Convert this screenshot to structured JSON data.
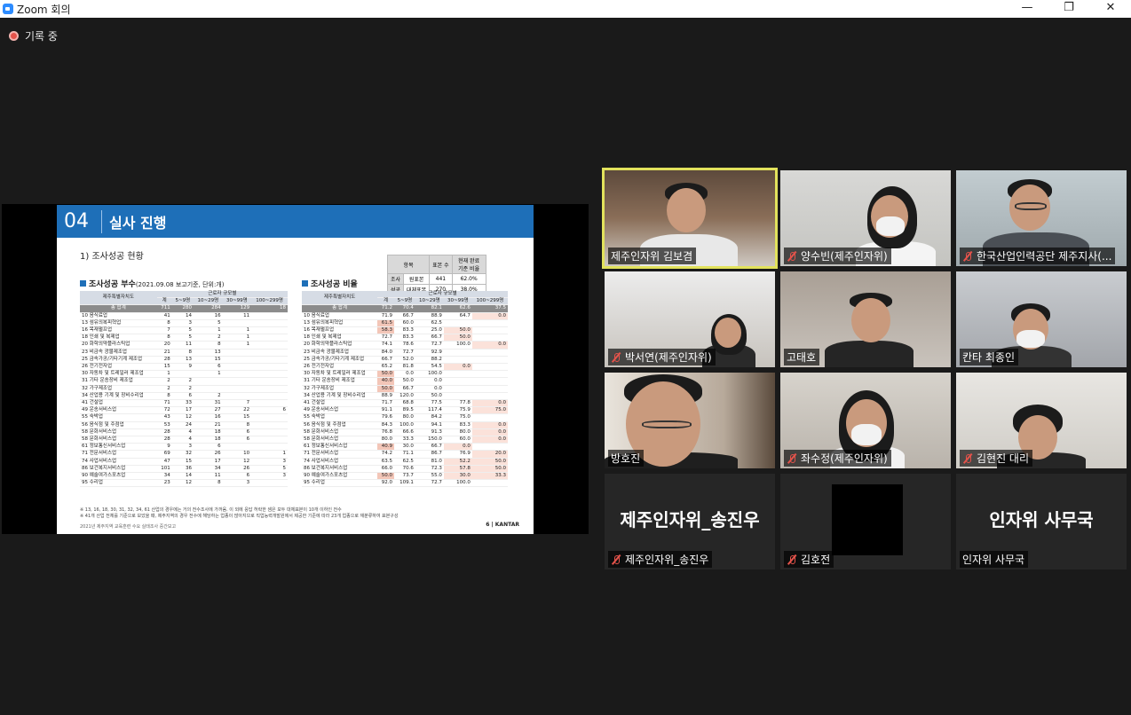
{
  "window": {
    "title": "Zoom 회의",
    "controls": {
      "minimize": "—",
      "restore": "❐",
      "close": "✕"
    }
  },
  "recording": {
    "label": "기록 중"
  },
  "slide": {
    "section_number": "04",
    "section_title": "실사 진행",
    "subtitle": "1) 조사성공 현황",
    "summary_table": {
      "headers": [
        "항목",
        "표본 수",
        "현재 완료 기준 비율"
      ],
      "rows": [
        [
          "조사",
          "원표본",
          "441",
          "62.0%"
        ],
        [
          "성공",
          "대체표본",
          "270",
          "38.0%"
        ]
      ]
    },
    "left_title": "조사성공 부수",
    "left_note": "(2021.09.08 보고기준, 단위:개)",
    "right_title": "조사성공 비율",
    "group_header": "근로자 규모별",
    "col_header": "제주특별자치도",
    "columns": [
      "계",
      "5~9명",
      "10~29명",
      "30~99명",
      "100~299명"
    ],
    "total_label": "총 합계",
    "left_total": [
      "711",
      "280",
      "284",
      "129",
      "18"
    ],
    "right_total": [
      "71.2",
      "70.4",
      "82.1",
      "62.6",
      "37.5"
    ],
    "rows": [
      {
        "label": "10 음식료업",
        "l": [
          "41",
          "14",
          "16",
          "11",
          ""
        ],
        "r": [
          "71.9",
          "66.7",
          "88.9",
          "64.7",
          "0.0"
        ]
      },
      {
        "label": "13 섬유의복피혁업",
        "l": [
          "8",
          "3",
          "5",
          "",
          ""
        ],
        "r": [
          "61.5",
          "60.0",
          "62.5",
          "",
          ""
        ]
      },
      {
        "label": "16 목재펄프업",
        "l": [
          "7",
          "5",
          "1",
          "1",
          ""
        ],
        "r": [
          "58.3",
          "83.3",
          "25.0",
          "50.0",
          ""
        ]
      },
      {
        "label": "18 인쇄 및 복제업",
        "l": [
          "8",
          "5",
          "2",
          "1",
          ""
        ],
        "r": [
          "72.7",
          "83.3",
          "66.7",
          "50.0",
          ""
        ]
      },
      {
        "label": "20 화학의약플라스틱업",
        "l": [
          "20",
          "11",
          "8",
          "1",
          ""
        ],
        "r": [
          "74.1",
          "78.6",
          "72.7",
          "100.0",
          "0.0"
        ]
      },
      {
        "label": "23 비금속 광물제조업",
        "l": [
          "21",
          "8",
          "13",
          "",
          ""
        ],
        "r": [
          "84.0",
          "72.7",
          "92.9",
          "",
          ""
        ]
      },
      {
        "label": "25 금속가공/기타기계 제조업",
        "l": [
          "28",
          "13",
          "15",
          "",
          ""
        ],
        "r": [
          "66.7",
          "52.0",
          "88.2",
          "",
          ""
        ]
      },
      {
        "label": "26 전기전자업",
        "l": [
          "15",
          "9",
          "6",
          "",
          ""
        ],
        "r": [
          "65.2",
          "81.8",
          "54.5",
          "0.0",
          ""
        ]
      },
      {
        "label": "30 자동차 및 트레일러 제조업",
        "l": [
          "1",
          "",
          "1",
          "",
          ""
        ],
        "r": [
          "50.0",
          "0.0",
          "100.0",
          "",
          ""
        ]
      },
      {
        "label": "31 기타 운송장비 제조업",
        "l": [
          "2",
          "2",
          "",
          "",
          ""
        ],
        "r": [
          "40.0",
          "50.0",
          "0.0",
          "",
          ""
        ]
      },
      {
        "label": "32 가구제조업",
        "l": [
          "2",
          "2",
          "",
          "",
          ""
        ],
        "r": [
          "50.0",
          "66.7",
          "0.0",
          "",
          ""
        ]
      },
      {
        "label": "34 산업용 기계 및 장비수리업",
        "l": [
          "8",
          "6",
          "2",
          "",
          ""
        ],
        "r": [
          "88.9",
          "120.0",
          "50.0",
          "",
          ""
        ]
      },
      {
        "label": "41 건설업",
        "l": [
          "71",
          "33",
          "31",
          "7",
          ""
        ],
        "r": [
          "71.7",
          "68.8",
          "77.5",
          "77.8",
          "0.0"
        ]
      },
      {
        "label": "49 운송서비스업",
        "l": [
          "72",
          "17",
          "27",
          "22",
          "6"
        ],
        "r": [
          "91.1",
          "89.5",
          "117.4",
          "75.9",
          "75.0"
        ]
      },
      {
        "label": "55 숙박업",
        "l": [
          "43",
          "12",
          "16",
          "15",
          ""
        ],
        "r": [
          "79.6",
          "80.0",
          "84.2",
          "75.0",
          ""
        ]
      },
      {
        "label": "56 음식점 및 주점업",
        "l": [
          "53",
          "24",
          "21",
          "8",
          ""
        ],
        "r": [
          "84.3",
          "100.0",
          "94.1",
          "83.3",
          "0.0"
        ]
      },
      {
        "label": "58 문화서비스업",
        "l": [
          "28",
          "4",
          "18",
          "6",
          ""
        ],
        "r": [
          "76.8",
          "66.6",
          "91.3",
          "80.0",
          "0.0"
        ]
      },
      {
        "label": "58 문화서비스업",
        "l": [
          "28",
          "4",
          "18",
          "6",
          ""
        ],
        "r": [
          "80.0",
          "33.3",
          "150.0",
          "60.0",
          "0.0"
        ]
      },
      {
        "label": "61 정보통신서비스업",
        "l": [
          "9",
          "3",
          "6",
          "",
          ""
        ],
        "r": [
          "40.9",
          "30.0",
          "66.7",
          "0.0",
          ""
        ]
      },
      {
        "label": "71 전문서비스업",
        "l": [
          "69",
          "32",
          "26",
          "10",
          "1"
        ],
        "r": [
          "74.2",
          "71.1",
          "86.7",
          "76.9",
          "20.0"
        ]
      },
      {
        "label": "74 사업서비스업",
        "l": [
          "47",
          "15",
          "17",
          "12",
          "3"
        ],
        "r": [
          "63.5",
          "62.5",
          "81.0",
          "52.2",
          "50.0"
        ]
      },
      {
        "label": "86 보건복지서비스업",
        "l": [
          "101",
          "36",
          "34",
          "26",
          "5"
        ],
        "r": [
          "66.0",
          "70.6",
          "72.3",
          "57.8",
          "50.0"
        ]
      },
      {
        "label": "90 예술여가스포츠업",
        "l": [
          "34",
          "14",
          "11",
          "6",
          "3"
        ],
        "r": [
          "50.0",
          "73.7",
          "55.0",
          "30.0",
          "33.3"
        ]
      },
      {
        "label": "95 수리업",
        "l": [
          "23",
          "12",
          "8",
          "3",
          ""
        ],
        "r": [
          "92.0",
          "109.1",
          "72.7",
          "100.0",
          ""
        ]
      }
    ],
    "footnote1": "※ 13, 16, 18, 30, 31, 32, 34, 61 산업의 경우에는 거의 전수조사에 가까움. 이 외에 응답 허락한 셈은 모두 대체표본이 10개 이하인 전수",
    "footnote2": "※ 41개 산업 전체를 기준으로 보았을 때, 제주지역의 경우 전수에 해당하는 업종이 많아지므로 직업능력개발원에서 제공한 기준에 따라 23개 업종으로 재분류하여 표본구성",
    "footer_left": "2021년 제주지역 교육훈련 수요 실태조사 중간보고",
    "page_num": "6",
    "brand": "KANTAR"
  },
  "participants": [
    {
      "name": "제주인자위 김보겸",
      "muted": false,
      "active": true
    },
    {
      "name": "양수빈(제주인자위)",
      "muted": true
    },
    {
      "name": "한국산업인력공단 제주지사(...",
      "muted": true
    },
    {
      "name": "박서연(제주인자위)",
      "muted": true
    },
    {
      "name": "고태호",
      "muted": false
    },
    {
      "name": "칸타 최종인",
      "muted": false
    },
    {
      "name": "방호진",
      "muted": false
    },
    {
      "name": "좌수정(제주인자위)",
      "muted": true
    },
    {
      "name": "김현진 대리",
      "muted": true
    },
    {
      "name": "제주인자위_송진우",
      "muted": true,
      "big": "제주인자위_송진우"
    },
    {
      "name": "김호전",
      "muted": true
    },
    {
      "name": "인자위 사무국",
      "muted": false,
      "big": "인자위 사무국"
    }
  ]
}
